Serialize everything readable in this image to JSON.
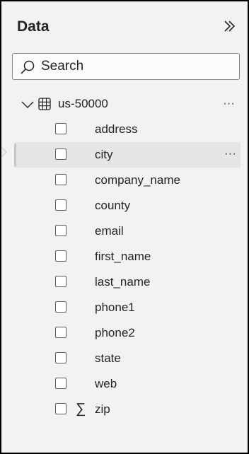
{
  "panel": {
    "title": "Data",
    "expand_icon": "double-chevron-right-icon"
  },
  "search": {
    "placeholder": "Search",
    "value": "",
    "icon": "search-icon"
  },
  "table": {
    "name": "us-50000",
    "expanded": true,
    "icon": "table-icon",
    "more_label": "···"
  },
  "fields": [
    {
      "name": "address",
      "checked": false,
      "icon": ""
    },
    {
      "name": "city",
      "checked": false,
      "icon": "",
      "selected": true,
      "more_label": "···"
    },
    {
      "name": "company_name",
      "checked": false,
      "icon": ""
    },
    {
      "name": "county",
      "checked": false,
      "icon": ""
    },
    {
      "name": "email",
      "checked": false,
      "icon": ""
    },
    {
      "name": "first_name",
      "checked": false,
      "icon": ""
    },
    {
      "name": "last_name",
      "checked": false,
      "icon": ""
    },
    {
      "name": "phone1",
      "checked": false,
      "icon": ""
    },
    {
      "name": "phone2",
      "checked": false,
      "icon": ""
    },
    {
      "name": "state",
      "checked": false,
      "icon": ""
    },
    {
      "name": "web",
      "checked": false,
      "icon": ""
    },
    {
      "name": "zip",
      "checked": false,
      "icon": "sigma-icon",
      "icon_glyph": "∑"
    }
  ],
  "colors": {
    "background": "#f3f2f1",
    "text": "#252423",
    "selected_row": "#e6e6e6",
    "border": "#8a8886"
  }
}
